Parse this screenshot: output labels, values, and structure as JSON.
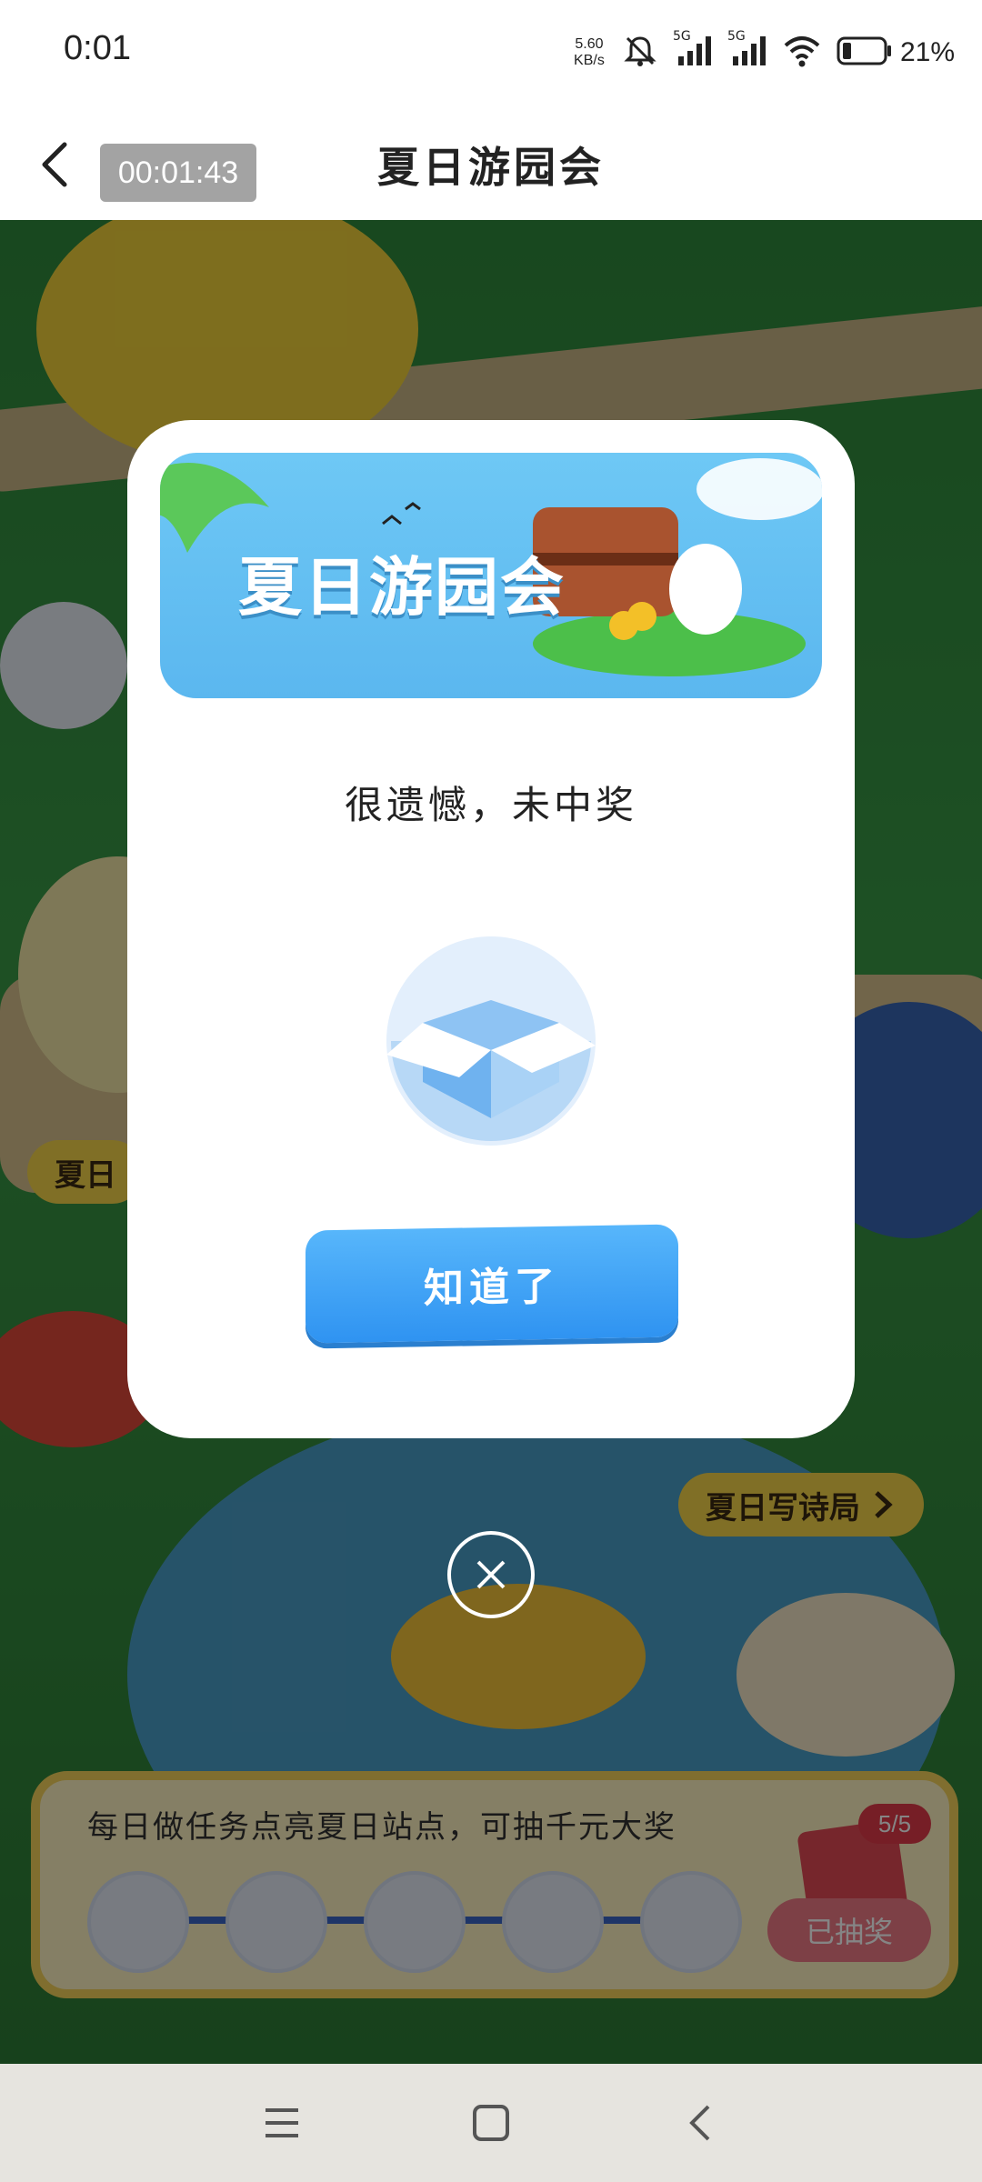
{
  "status_bar": {
    "time": "0:01",
    "net_speed_value": "5.60",
    "net_speed_unit": "KB/s",
    "signal1_label": "5G",
    "signal2_label": "5G",
    "battery_percent": "21%",
    "icons": [
      "mute-icon",
      "signal-icon",
      "signal-icon",
      "wifi-icon",
      "battery-icon"
    ]
  },
  "title_bar": {
    "timer": "00:01:43",
    "title": "夏日游园会"
  },
  "scene": {
    "site_tag_1": "夏日写诗局",
    "site_tag_2": "夏日",
    "panel_text": "每日做任务点亮夏日站点，可抽千元大奖",
    "count_badge": "5/5",
    "draw_button": "已抽奖"
  },
  "modal": {
    "banner_title": "夏日游园会",
    "result_text": "很遗憾，未中奖",
    "ok_button": "知道了"
  },
  "colors": {
    "accent_blue": "#2f93f1",
    "banner_blue": "#6ec8f5",
    "modal_bg": "#ffffff"
  }
}
